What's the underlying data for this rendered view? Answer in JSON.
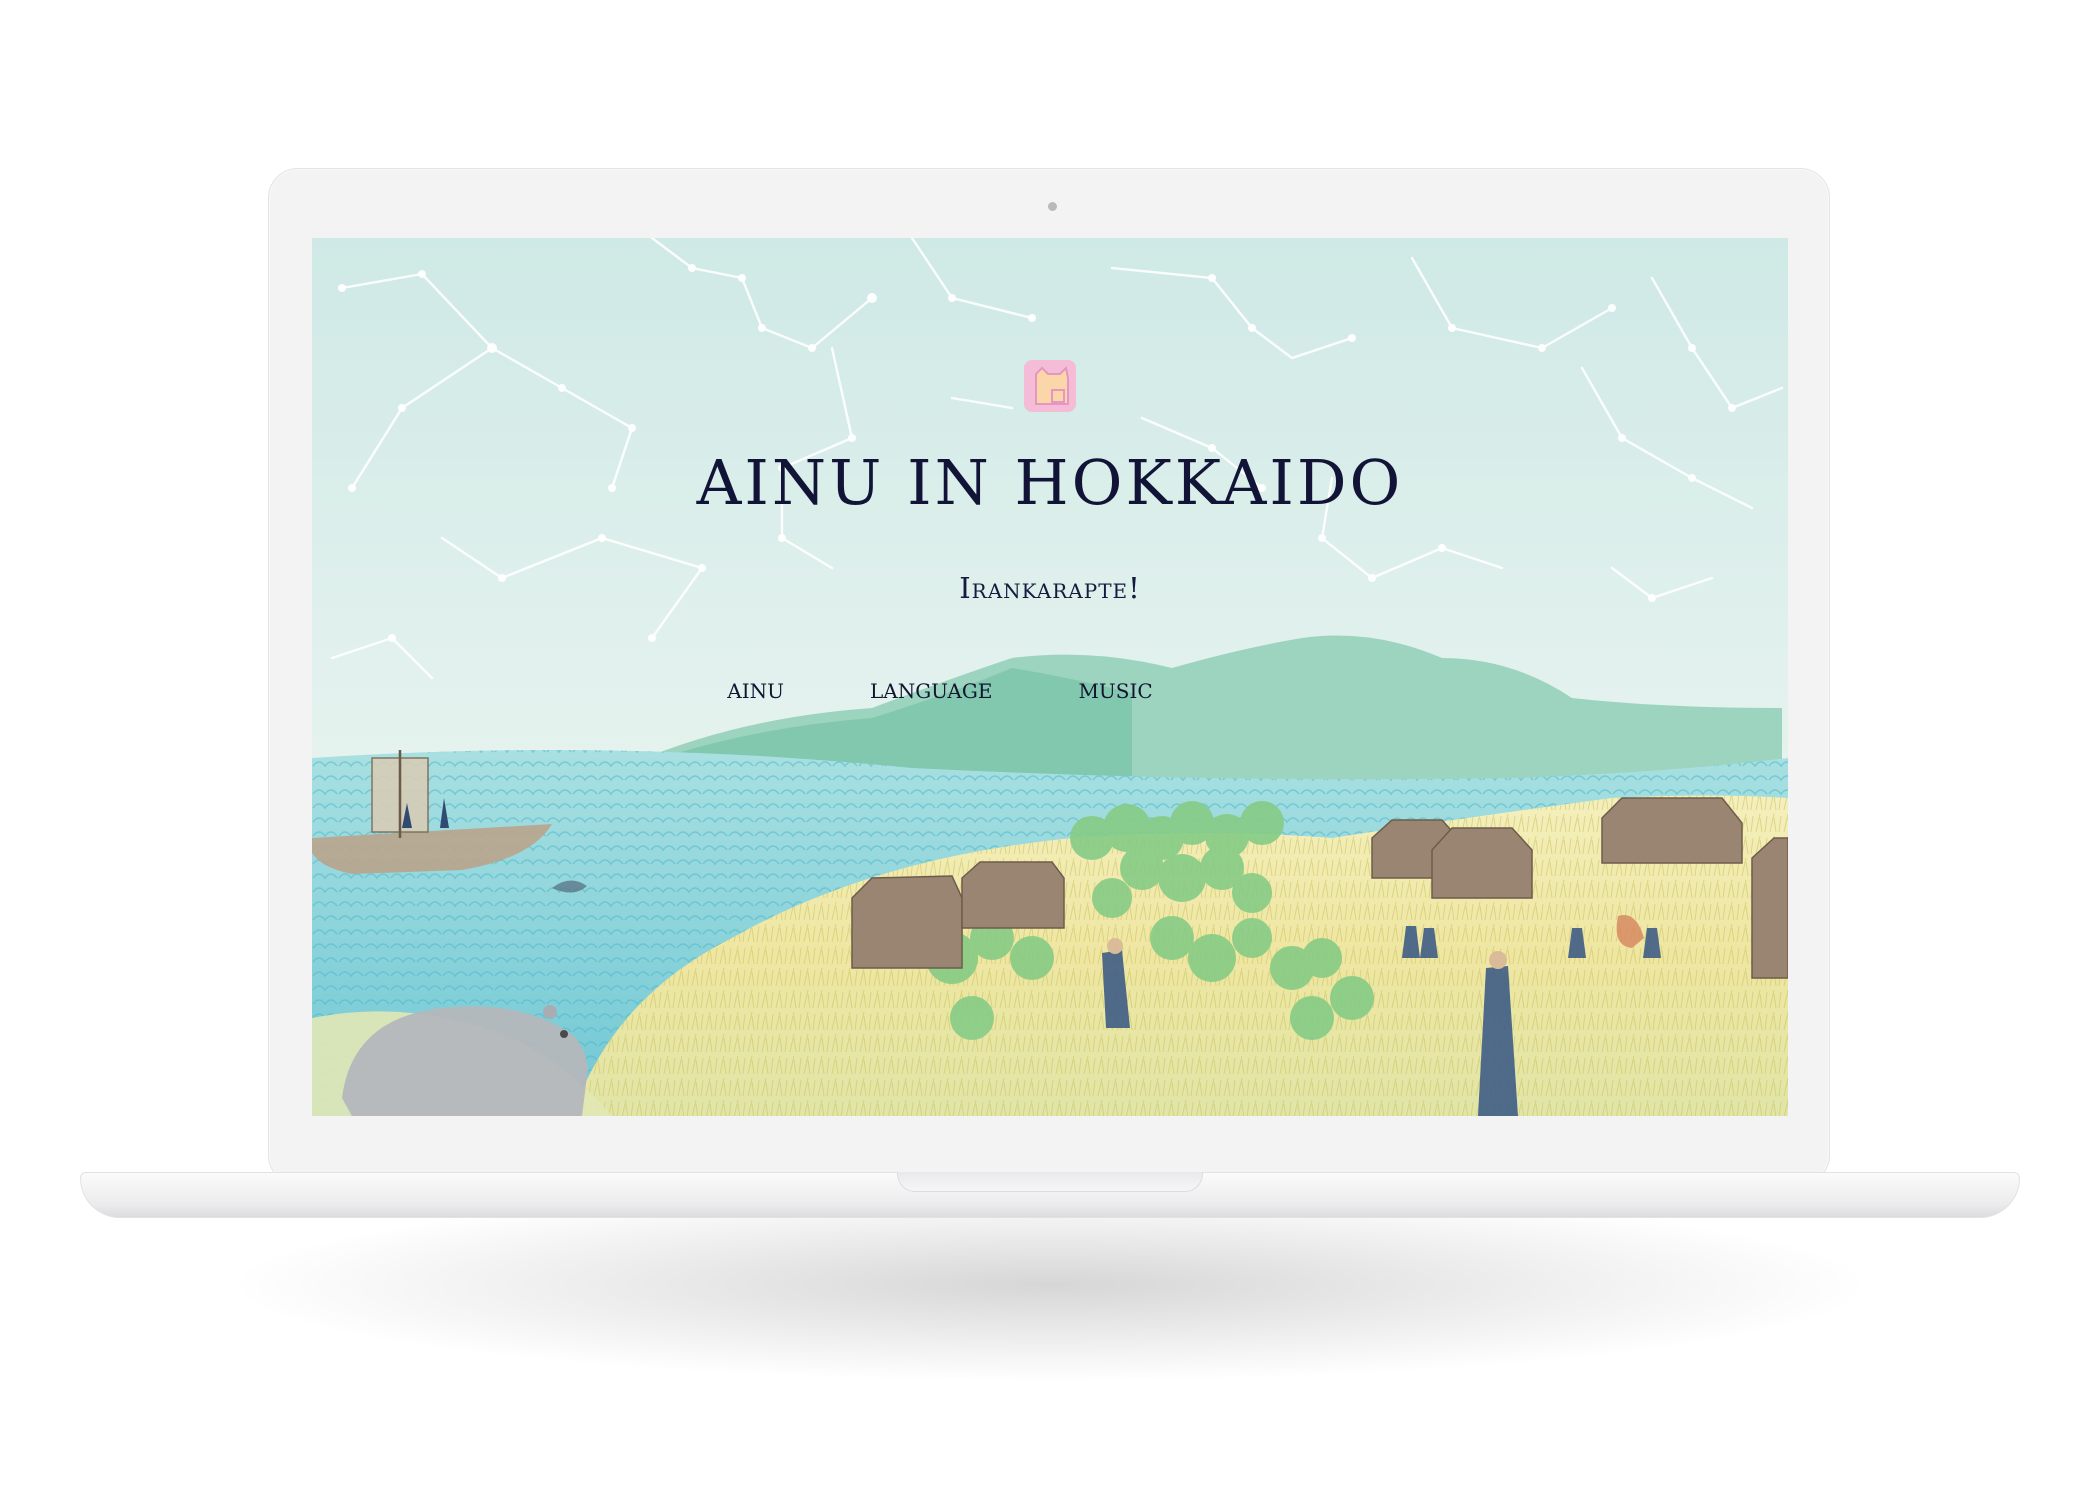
{
  "site": {
    "title": "AINU IN HOKKAIDO",
    "tagline": "Irankarapte!"
  },
  "nav": {
    "items": [
      {
        "label": "AINU"
      },
      {
        "label": "LANGUAGE"
      },
      {
        "label": "MUSIC"
      }
    ]
  },
  "logo": {
    "icon": "pink-bear-emblem-icon"
  },
  "colors": {
    "title": "#111437",
    "sky": "#dcefec",
    "sea": "#7fd0d6",
    "field": "#efe7a8",
    "logo": "#f7b7d4"
  }
}
